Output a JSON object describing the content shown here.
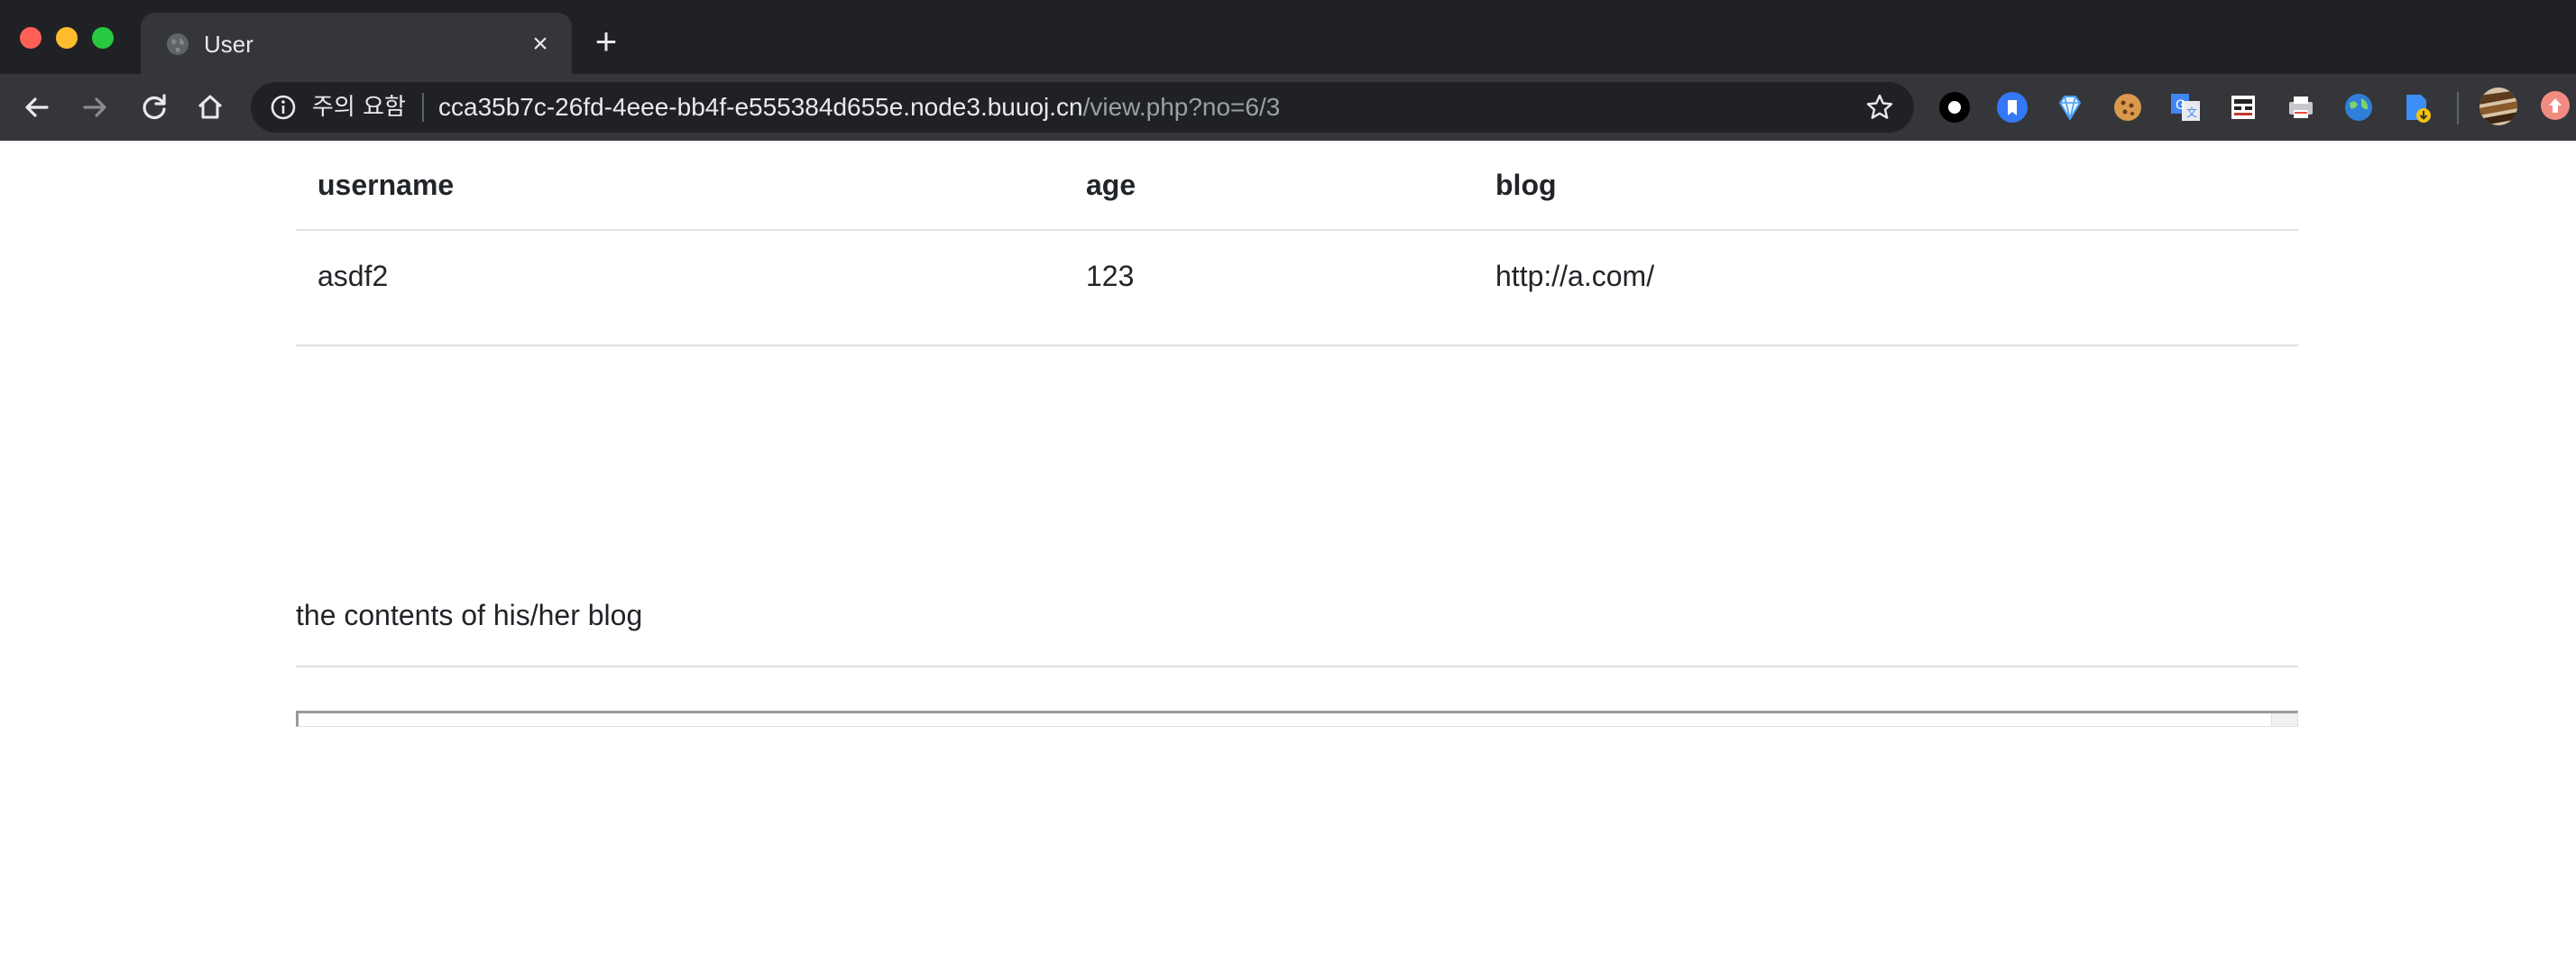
{
  "browser": {
    "tab": {
      "title": "User",
      "close_label": "×"
    },
    "new_tab_label": "+",
    "omnibox": {
      "security_label": "주의 요함",
      "url_host": "cca35b7c-26fd-4eee-bb4f-e555384d655e.node3.buuoj.cn",
      "url_path": "/view.php?no=6/3"
    },
    "extension_icons": [
      "circle-extension-icon",
      "bookmark-extension-icon",
      "diamond-extension-icon",
      "cookie-extension-icon",
      "translate-extension-icon",
      "incognito-extension-icon",
      "printer-extension-icon",
      "globe-extension-icon",
      "download-extension-icon"
    ],
    "colors": {
      "chrome_dark": "#202124",
      "chrome_toolbar": "#35363a",
      "text": "#e8eaed"
    }
  },
  "table": {
    "headers": [
      "username",
      "age",
      "blog"
    ],
    "rows": [
      [
        "asdf2",
        "123",
        "http://a.com/"
      ]
    ]
  },
  "blog_section": {
    "heading": "the contents of his/her blog"
  }
}
